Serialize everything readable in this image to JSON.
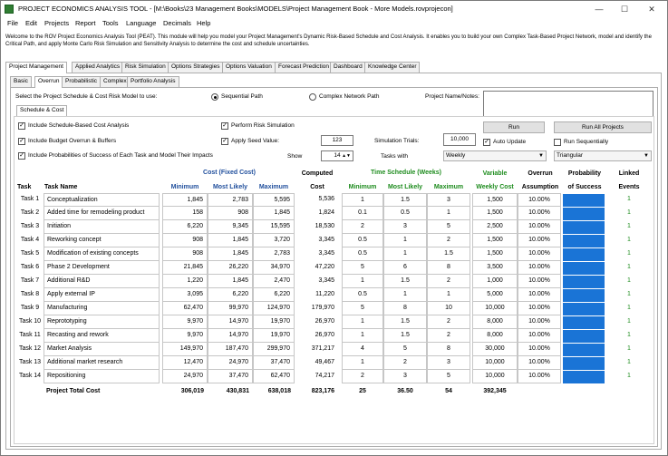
{
  "window": {
    "title": "PROJECT ECONOMICS ANALYSIS TOOL - [M:\\Books\\23 Management Books\\MODELS\\Project Management Book - More Models.rovprojecon]",
    "controls": [
      "—",
      "☐",
      "✕"
    ]
  },
  "menu": [
    "File",
    "Edit",
    "Projects",
    "Report",
    "Tools",
    "Language",
    "Decimals",
    "Help"
  ],
  "intro": "Welcome to the ROV Project Economics Analysis Tool (PEAT). This module will help you model your Project Management's Dynamic Risk-Based Schedule and Cost Analysis. It enables you to build your own Complex Task-Based Project Network, model and identify the Critical Path, and apply Monte Carlo Risk Simulation and Sensitivity Analysis to determine the cost and schedule uncertainties.",
  "main_tabs": [
    "Project Management",
    "Applied Analytics",
    "Risk Simulation",
    "Options Strategies",
    "Options Valuation",
    "Forecast Prediction",
    "Dashboard",
    "Knowledge Center"
  ],
  "sub_tabs": [
    "Basic",
    "Overrun",
    "Probabilistic",
    "Complex",
    "Portfolio Analysis"
  ],
  "controls": {
    "select_label": "Select the Project Schedule & Cost Risk Model to use:",
    "sequential": "Sequential Path",
    "complex": "Complex Network Path",
    "notes_label": "Project Name/Notes:",
    "schedule_cost_tab": "Schedule & Cost",
    "cb_schedule": "Include Schedule-Based Cost Analysis",
    "cb_budget": "Include Budget Overrun & Buffers",
    "cb_prob": "Include Probabilities of Success of Each Task and Model Their Impacts",
    "cb_risk": "Perform Risk Simulation",
    "cb_seed": "Apply Seed Value:",
    "seed_value": "123",
    "trials_label": "Simulation Trials:",
    "trials_value": "10,000",
    "show_label": "Show",
    "show_value": "14",
    "tasks_with_label": "Tasks with",
    "tasks_with_value": "Weekly",
    "distribution": "Triangular",
    "run": "Run",
    "run_all": "Run All Projects",
    "auto_update": "Auto Update",
    "run_seq": "Run Sequentially"
  },
  "headers": {
    "cost_group": "Cost (Fixed Cost)",
    "computed": "Computed",
    "time_group": "Time Schedule (Weeks)",
    "variable": "Variable",
    "overrun": "Overrun",
    "probability": "Probability",
    "linked": "Linked",
    "task": "Task",
    "task_name": "Task Name",
    "minimum": "Minimum",
    "most_likely": "Most Likely",
    "maximum": "Maximum",
    "cost": "Cost",
    "weekly_cost": "Weekly Cost",
    "assumption": "Assumption",
    "of_success": "of Success",
    "events": "Events"
  },
  "rows": [
    {
      "task": "Task 1",
      "name": "Conceptualization",
      "cmin": "1,845",
      "cml": "2,783",
      "cmax": "5,595",
      "computed": "5,536",
      "tmin": "1",
      "tml": "1.5",
      "tmax": "3",
      "weekly": "1,500",
      "overrun": "10.00%",
      "linked": "1"
    },
    {
      "task": "Task 2",
      "name": "Added time for remodeling product",
      "cmin": "158",
      "cml": "908",
      "cmax": "1,845",
      "computed": "1,824",
      "tmin": "0.1",
      "tml": "0.5",
      "tmax": "1",
      "weekly": "1,500",
      "overrun": "10.00%",
      "linked": "1"
    },
    {
      "task": "Task 3",
      "name": "Initiation",
      "cmin": "6,220",
      "cml": "9,345",
      "cmax": "15,595",
      "computed": "18,530",
      "tmin": "2",
      "tml": "3",
      "tmax": "5",
      "weekly": "2,500",
      "overrun": "10.00%",
      "linked": "1"
    },
    {
      "task": "Task 4",
      "name": "Reworking concept",
      "cmin": "908",
      "cml": "1,845",
      "cmax": "3,720",
      "computed": "3,345",
      "tmin": "0.5",
      "tml": "1",
      "tmax": "2",
      "weekly": "1,500",
      "overrun": "10.00%",
      "linked": "1"
    },
    {
      "task": "Task 5",
      "name": "Modification of existing concepts",
      "cmin": "908",
      "cml": "1,845",
      "cmax": "2,783",
      "computed": "3,345",
      "tmin": "0.5",
      "tml": "1",
      "tmax": "1.5",
      "weekly": "1,500",
      "overrun": "10.00%",
      "linked": "1"
    },
    {
      "task": "Task 6",
      "name": "Phase 2 Development",
      "cmin": "21,845",
      "cml": "26,220",
      "cmax": "34,970",
      "computed": "47,220",
      "tmin": "5",
      "tml": "6",
      "tmax": "8",
      "weekly": "3,500",
      "overrun": "10.00%",
      "linked": "1"
    },
    {
      "task": "Task 7",
      "name": "Additional R&D",
      "cmin": "1,220",
      "cml": "1,845",
      "cmax": "2,470",
      "computed": "3,345",
      "tmin": "1",
      "tml": "1.5",
      "tmax": "2",
      "weekly": "1,000",
      "overrun": "10.00%",
      "linked": "1"
    },
    {
      "task": "Task 8",
      "name": "Apply external IP",
      "cmin": "3,095",
      "cml": "6,220",
      "cmax": "6,220",
      "computed": "11,220",
      "tmin": "0.5",
      "tml": "1",
      "tmax": "1",
      "weekly": "5,000",
      "overrun": "10.00%",
      "linked": "1"
    },
    {
      "task": "Task 9",
      "name": "Manufacturing",
      "cmin": "62,470",
      "cml": "99,970",
      "cmax": "124,970",
      "computed": "179,970",
      "tmin": "5",
      "tml": "8",
      "tmax": "10",
      "weekly": "10,000",
      "overrun": "10.00%",
      "linked": "1"
    },
    {
      "task": "Task 10",
      "name": "Reprototyping",
      "cmin": "9,970",
      "cml": "14,970",
      "cmax": "19,970",
      "computed": "26,970",
      "tmin": "1",
      "tml": "1.5",
      "tmax": "2",
      "weekly": "8,000",
      "overrun": "10.00%",
      "linked": "1"
    },
    {
      "task": "Task 11",
      "name": "Recasting and rework",
      "cmin": "9,970",
      "cml": "14,970",
      "cmax": "19,970",
      "computed": "26,970",
      "tmin": "1",
      "tml": "1.5",
      "tmax": "2",
      "weekly": "8,000",
      "overrun": "10.00%",
      "linked": "1"
    },
    {
      "task": "Task 12",
      "name": "Market Analysis",
      "cmin": "149,970",
      "cml": "187,470",
      "cmax": "299,970",
      "computed": "371,217",
      "tmin": "4",
      "tml": "5",
      "tmax": "8",
      "weekly": "30,000",
      "overrun": "10.00%",
      "linked": "1"
    },
    {
      "task": "Task 13",
      "name": "Additional market research",
      "cmin": "12,470",
      "cml": "24,970",
      "cmax": "37,470",
      "computed": "49,467",
      "tmin": "1",
      "tml": "2",
      "tmax": "3",
      "weekly": "10,000",
      "overrun": "10.00%",
      "linked": "1"
    },
    {
      "task": "Task 14",
      "name": "Repositioning",
      "cmin": "24,970",
      "cml": "37,470",
      "cmax": "62,470",
      "computed": "74,217",
      "tmin": "2",
      "tml": "3",
      "tmax": "5",
      "weekly": "10,000",
      "overrun": "10.00%",
      "linked": "1"
    }
  ],
  "totals": {
    "label": "Project Total Cost",
    "cmin": "306,019",
    "cml": "430,831",
    "cmax": "638,018",
    "computed": "823,176",
    "tmin": "25",
    "tml": "36.50",
    "tmax": "54",
    "weekly": "392,345"
  },
  "colors": {
    "probability_fill": "#1a74d6",
    "header_blue": "#1f4e9c",
    "header_green": "#1e8c1e"
  }
}
